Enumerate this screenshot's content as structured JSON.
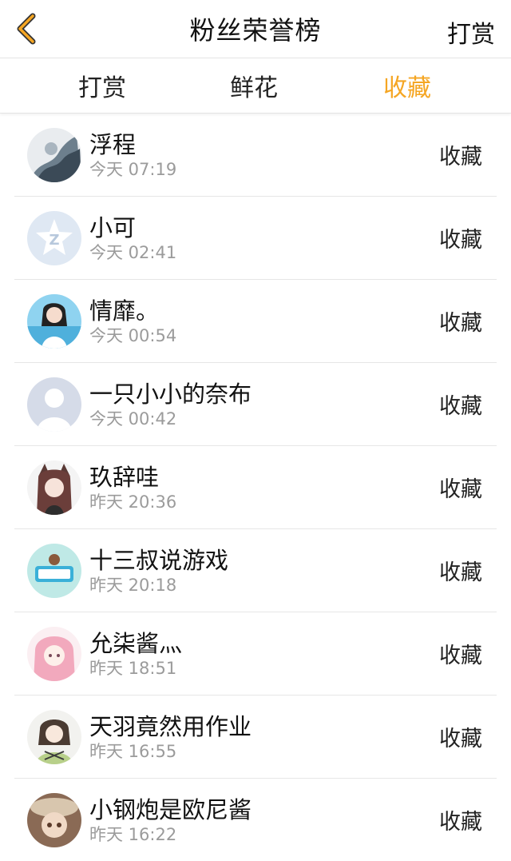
{
  "header": {
    "title": "粉丝荣誉榜",
    "right_label": "打赏",
    "back_icon": "chevron-left-icon",
    "back_color": "#f5a623"
  },
  "tabs": [
    {
      "label": "打赏",
      "active": false
    },
    {
      "label": "鲜花",
      "active": false
    },
    {
      "label": "收藏",
      "active": true
    }
  ],
  "accent_color": "#f5a623",
  "list": [
    {
      "name": "浮程",
      "time": "今天 07:19",
      "action": "收藏",
      "avatar": "ink-painting-avatar"
    },
    {
      "name": "小可",
      "time": "今天 02:41",
      "action": "收藏",
      "avatar": "qq-logo-avatar"
    },
    {
      "name": "情靡。",
      "time": "今天 00:54",
      "action": "收藏",
      "avatar": "girl-photo-avatar"
    },
    {
      "name": "一只小小的奈布",
      "time": "今天 00:42",
      "action": "收藏",
      "avatar": "default-avatar"
    },
    {
      "name": "玖辞哇",
      "time": "昨天 20:36",
      "action": "收藏",
      "avatar": "anime-fox-avatar"
    },
    {
      "name": "十三叔说游戏",
      "time": "昨天 20:18",
      "action": "收藏",
      "avatar": "game-logo-avatar"
    },
    {
      "name": "允柒酱灬",
      "time": "昨天 18:51",
      "action": "收藏",
      "avatar": "anime-pink-hair-avatar"
    },
    {
      "name": "天羽竟然用作业",
      "time": "昨天 16:55",
      "action": "收藏",
      "avatar": "anime-character-avatar"
    },
    {
      "name": "小钢炮是欧尼酱",
      "time": "昨天 16:22",
      "action": "收藏",
      "avatar": "doll-face-avatar"
    }
  ]
}
